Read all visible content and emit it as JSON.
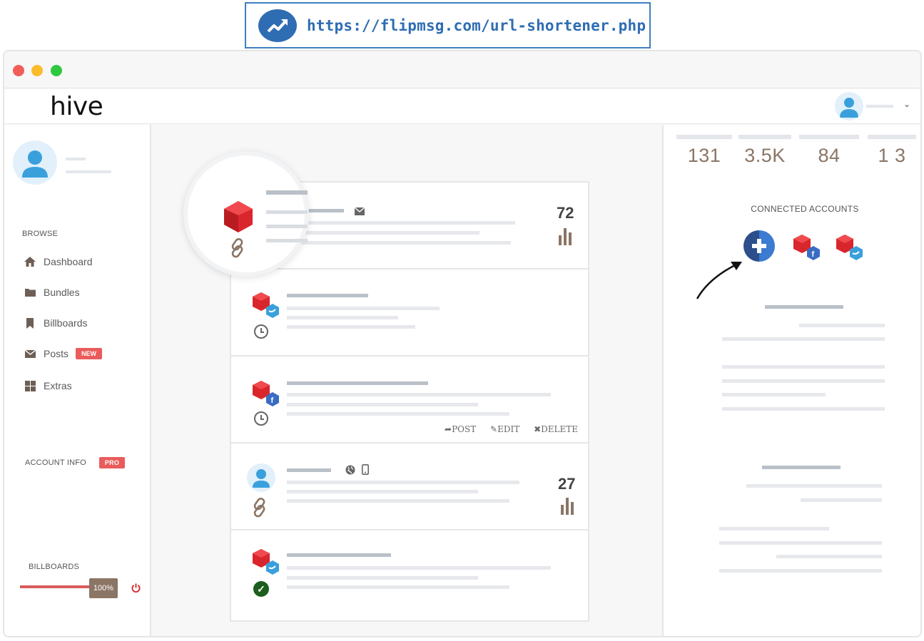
{
  "banner": {
    "url": "https://flipmsg.com/url-shortener.php",
    "icon": "trending-up-icon"
  },
  "app": {
    "logo": "hive"
  },
  "sidebar": {
    "browse_heading": "BROWSE",
    "items": [
      {
        "label": "Dashboard",
        "icon": "home-icon"
      },
      {
        "label": "Bundles",
        "icon": "folder-icon"
      },
      {
        "label": "Billboards",
        "icon": "bookmark-icon"
      },
      {
        "label": "Posts",
        "icon": "envelope-icon",
        "badge": "NEW"
      },
      {
        "label": "Extras",
        "icon": "grid-icon"
      }
    ],
    "account_info": "ACCOUNT INFO",
    "account_badge": "PRO",
    "billboards_heading": "BILLBOARDS",
    "progress_percent": 100,
    "progress_label": "100%"
  },
  "feed": {
    "cards": [
      {
        "count": "72"
      },
      {},
      {
        "actions": {
          "post": "POST",
          "edit": "EDIT",
          "delete": "DELETE"
        }
      },
      {
        "count": "27"
      },
      {}
    ]
  },
  "stats": [
    {
      "value": "131"
    },
    {
      "value": "3.5K"
    },
    {
      "value": "84"
    },
    {
      "value": "1 3"
    }
  ],
  "connected_accounts": {
    "label": "CONNECTED ACCOUNTS"
  },
  "colors": {
    "accent": "#8b7565",
    "badge": "#ea5b5b",
    "link": "#2f6db3"
  }
}
